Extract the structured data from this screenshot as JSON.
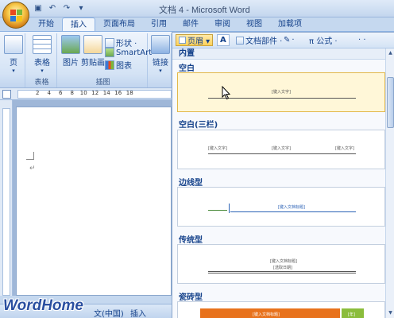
{
  "window": {
    "title": "文档 4 - Microsoft Word"
  },
  "qat": {
    "save_icon": "save-icon",
    "undo_icon": "undo-icon",
    "redo_icon": "redo-icon"
  },
  "tabs": [
    {
      "label": "开始"
    },
    {
      "label": "插入",
      "active": true
    },
    {
      "label": "页面布局"
    },
    {
      "label": "引用"
    },
    {
      "label": "邮件"
    },
    {
      "label": "审阅"
    },
    {
      "label": "视图"
    },
    {
      "label": "加载项"
    }
  ],
  "ribbon": {
    "pages_btn": "页",
    "table_btn": "表格",
    "picture_btn": "图片",
    "clipart_btn": "剪贴画",
    "shapes_btn": "形状 ·",
    "smartart_btn": "SmartArt",
    "chart_btn": "图表",
    "link_btn": "链接",
    "group_tables": "表格",
    "group_illustrations": "插图"
  },
  "gallery": {
    "header_btn": "页眉 ▾",
    "textbox_btn": "A",
    "quickparts_btn": "文档部件 ·",
    "signature_btn": "·",
    "equation_btn": "π 公式 ·",
    "more_btn": "· ·",
    "section_title": "内置",
    "items": [
      {
        "label": "空白",
        "placeholder": "[键入文字]"
      },
      {
        "label": "空白(三栏)",
        "placeholders": [
          "[键入文字]",
          "[键入文字]",
          "[键入文字]"
        ]
      },
      {
        "label": "边线型",
        "placeholder": "[键入文档标题]"
      },
      {
        "label": "传统型",
        "placeholder_1": "[键入文档标题]",
        "placeholder_2": "[选取日期]"
      },
      {
        "label": "瓷砖型",
        "placeholder": "[键入文档标题]",
        "year": "[年]"
      }
    ]
  },
  "ruler": {
    "numbers": [
      "2",
      "4",
      "6",
      "8",
      "10",
      "12",
      "14",
      "16",
      "18"
    ]
  },
  "document": {
    "para_mark": "↵"
  },
  "status": {
    "language": "文(中国)",
    "mode": "插入"
  },
  "watermark": "WordHome",
  "colors": {
    "accent": "#15428b",
    "selected": "#fff7d8",
    "tile_orange": "#e8721c",
    "tile_green": "#8bbd3c"
  }
}
